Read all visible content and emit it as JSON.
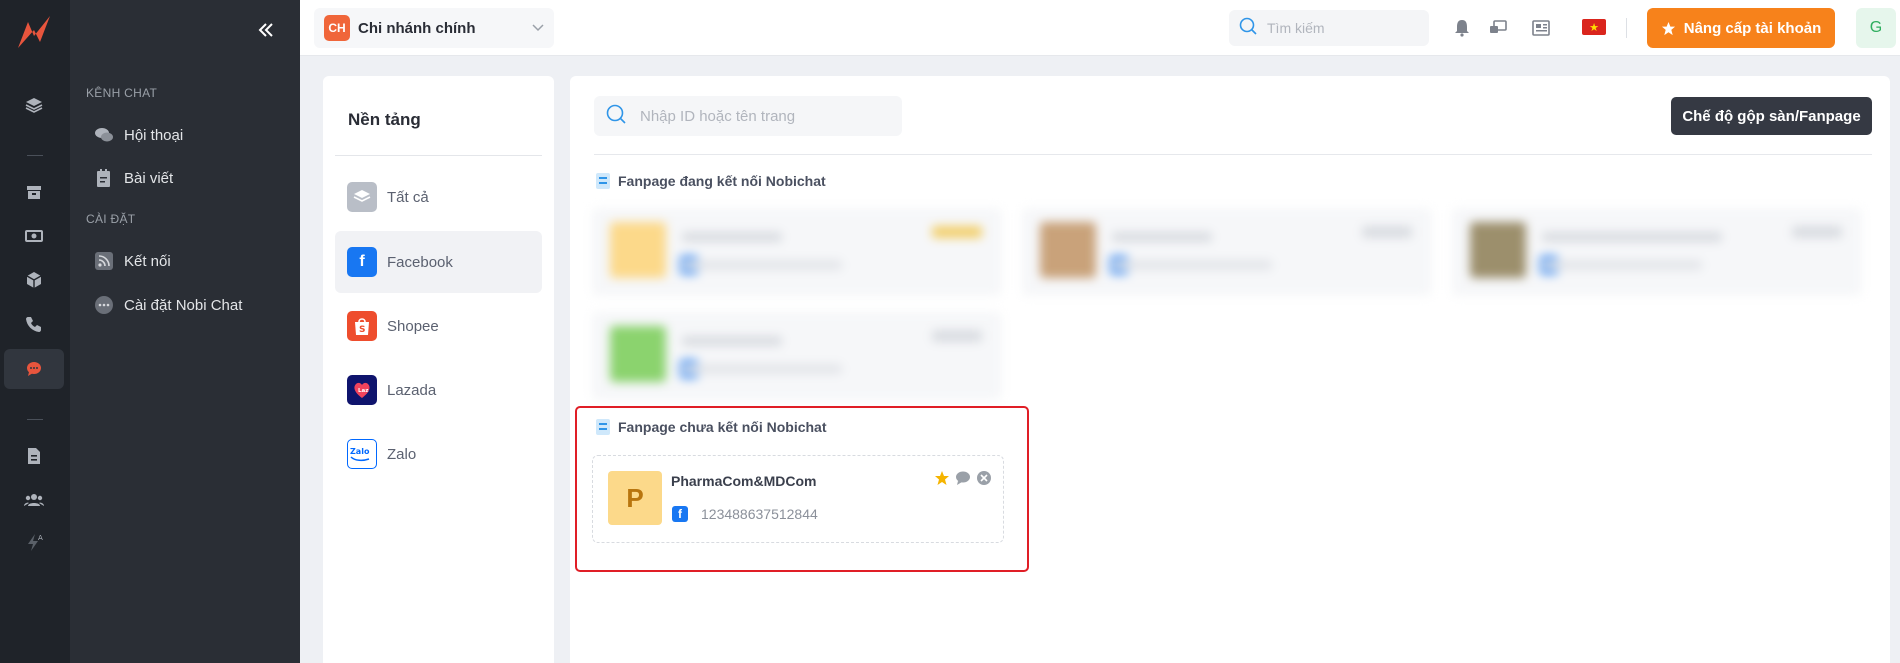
{
  "sidebar": {
    "sections": [
      {
        "label": "KÊNH CHAT",
        "items": [
          {
            "label": "Hội thoại",
            "icon": "chat-bubbles-icon"
          },
          {
            "label": "Bài viết",
            "icon": "article-icon"
          }
        ]
      },
      {
        "label": "CÀI ĐẶT",
        "items": [
          {
            "label": "Kết nối",
            "icon": "rss-icon"
          },
          {
            "label": "Cài đặt Nobi Chat",
            "icon": "more-dots-icon"
          }
        ]
      }
    ]
  },
  "topbar": {
    "branch_initials": "CH",
    "branch_name": "Chi nhánh chính",
    "search_placeholder": "Tìm kiếm",
    "upgrade_label": "Nâng cấp tài khoản",
    "avatar_initial": "G",
    "flag_color": "#da251d"
  },
  "platforms": {
    "title": "Nền tảng",
    "items": [
      {
        "label": "Tất cả",
        "icon": "layers-icon"
      },
      {
        "label": "Facebook",
        "icon": "facebook-icon"
      },
      {
        "label": "Shopee",
        "icon": "shopee-icon"
      },
      {
        "label": "Lazada",
        "icon": "lazada-icon"
      },
      {
        "label": "Zalo",
        "icon": "zalo-icon"
      }
    ],
    "selected": "Facebook"
  },
  "main": {
    "search_placeholder": "Nhập ID hoặc tên trang",
    "merge_button": "Chế độ gộp sàn/Fanpage",
    "connected_title": "Fanpage đang kết nối Nobichat",
    "unconnected_title": "Fanpage chưa kết nối Nobichat",
    "unconnected_pages": [
      {
        "initial": "P",
        "name": "PharmaCom&MDCom",
        "id": "123488637512844"
      }
    ]
  },
  "colors": {
    "accent": "#f7821b",
    "facebook": "#1877f2",
    "highlight": "#e01e26"
  }
}
